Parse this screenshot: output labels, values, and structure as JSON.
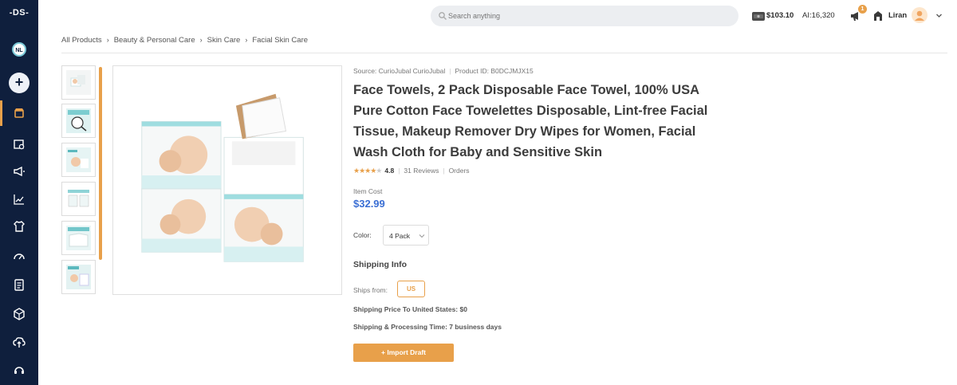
{
  "sidebar": {
    "logo": "-DS-",
    "avatar_initials": "NL",
    "add_symbol": "+",
    "items": [
      "store-icon",
      "catalog-icon",
      "megaphone-icon",
      "chart-icon",
      "shirt-icon",
      "gauge-icon",
      "clipboard-icon",
      "box-icon",
      "cloud-upload-icon",
      "support-icon"
    ]
  },
  "header": {
    "search_placeholder": "Search anything",
    "balance": "$103.10",
    "ai_credits": "AI:16,320",
    "notification_count": "1",
    "username": "Liran"
  },
  "breadcrumb": [
    "All Products",
    "Beauty & Personal Care",
    "Skin Care",
    "Facial Skin Care"
  ],
  "product": {
    "source": "Source: CurioJubal CurioJubal",
    "product_id": "Product ID: B0DCJMJX15",
    "title": "Face Towels, 2 Pack Disposable Face Towel, 100% USA Pure Cotton Face Towelettes Disposable, Lint-free Facial Tissue, Makeup Remover Dry Wipes for Women, Facial Wash Cloth for Baby and Sensitive Skin",
    "rating": "4.8",
    "rating_stars": 4.8,
    "reviews": "31 Reviews",
    "orders": "Orders",
    "cost_label": "Item Cost",
    "cost": "$32.99",
    "color_label": "Color:",
    "color_value": "4 Pack",
    "shipping_title": "Shipping Info",
    "ships_from_label": "Ships from:",
    "ships_from_value": "US",
    "shipping_price": "Shipping Price To United States: $0",
    "shipping_time": "Shipping & Processing Time: 7 business days",
    "import_button": "+ Import Draft"
  },
  "colors": {
    "sidebar_bg": "#0f1f3d",
    "accent": "#e8a04a",
    "price": "#3b6fd4"
  }
}
